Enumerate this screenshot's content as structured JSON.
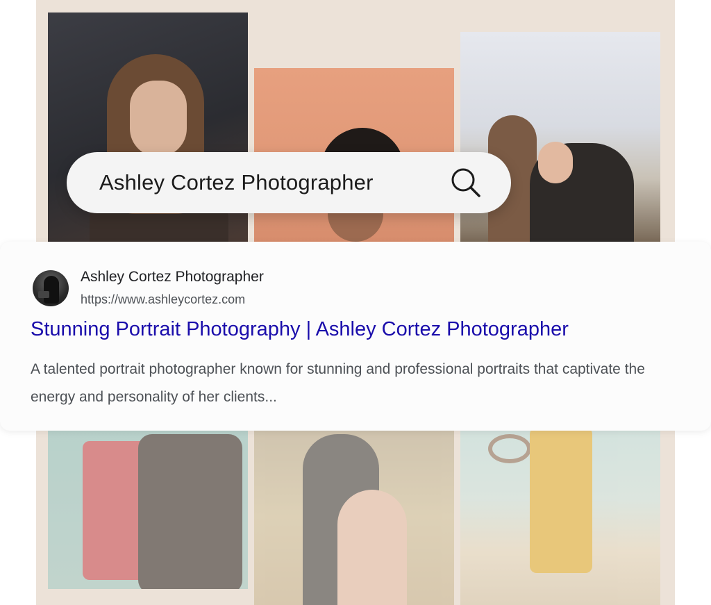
{
  "search": {
    "query": "Ashley Cortez Photographer",
    "icon": "search-icon"
  },
  "result": {
    "site_name": "Ashley Cortez Photographer",
    "url": "https://www.ashleycortez.com",
    "title": "Stunning Portrait Photography | Ashley Cortez Photographer",
    "snippet": "A talented portrait photographer known for stunning and professional portraits that captivate the energy and personality of her clients...",
    "avatar_icon": "photographer-avatar"
  },
  "colors": {
    "title_link": "#1a0dab",
    "snippet_text": "#4d5156",
    "gallery_background": "#ece2d8"
  }
}
